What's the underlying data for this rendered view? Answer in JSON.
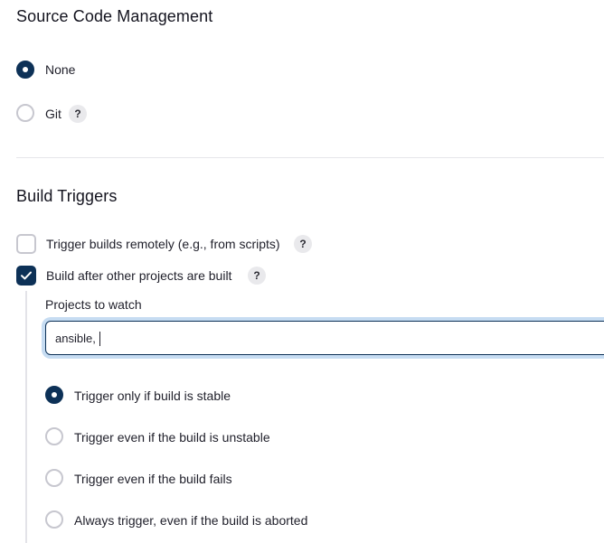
{
  "scm": {
    "title": "Source Code Management",
    "options": [
      {
        "label": "None",
        "selected": true
      },
      {
        "label": "Git",
        "selected": false,
        "help": "?"
      }
    ]
  },
  "build_triggers": {
    "title": "Build Triggers",
    "remote": {
      "label": "Trigger builds remotely (e.g., from scripts)",
      "checked": false,
      "help": "?"
    },
    "after_other": {
      "label": "Build after other projects are built",
      "checked": true,
      "help": "?"
    },
    "projects_to_watch": {
      "label": "Projects to watch",
      "value": "ansible, "
    },
    "trigger_options": [
      {
        "label": "Trigger only if build is stable",
        "selected": true
      },
      {
        "label": "Trigger even if the build is unstable",
        "selected": false
      },
      {
        "label": "Trigger even if the build fails",
        "selected": false
      },
      {
        "label": "Always trigger, even if the build is aborted",
        "selected": false
      }
    ]
  },
  "colors": {
    "accent": "#0d3157",
    "focus_ring": "#c6dcf2",
    "help_bg": "#e9e9ec"
  },
  "icons": {
    "check": "check-icon",
    "help": "help-icon"
  }
}
